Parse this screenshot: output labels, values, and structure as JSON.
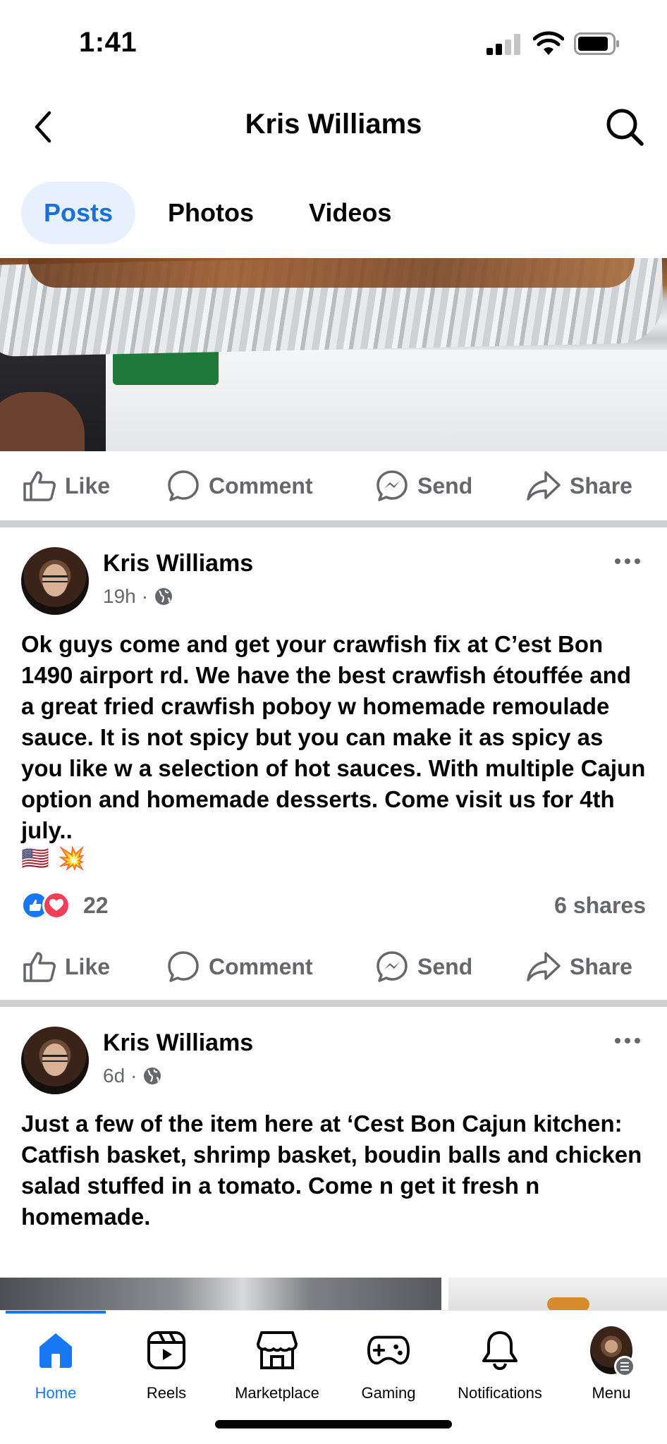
{
  "status_bar": {
    "time": "1:41"
  },
  "header": {
    "title": "Kris Williams"
  },
  "tabs": [
    {
      "label": "Posts",
      "active": true
    },
    {
      "label": "Photos",
      "active": false
    },
    {
      "label": "Videos",
      "active": false
    }
  ],
  "actions": {
    "like": "Like",
    "comment": "Comment",
    "send": "Send",
    "share": "Share"
  },
  "posts": [
    {
      "author": "Kris Williams",
      "time": "19h",
      "separator": "·",
      "text": "Ok guys come and get your crawfish fix at C’est Bon 1490 airport rd.  We have the best crawfish étouffée and a great fried crawfish poboy w homemade remoulade sauce.  It is not spicy but you can make it as spicy as you like w a selection of hot sauces.  With multiple Cajun option and homemade desserts.  Come visit us for 4th july..",
      "emojis": [
        "🇺🇸",
        "💥"
      ],
      "reaction_count": "22",
      "shares": "6 shares"
    },
    {
      "author": "Kris Williams",
      "time": "6d",
      "separator": "·",
      "text": "Just a few of the item here at ‘Cest Bon Cajun kitchen:\nCatfish basket, shrimp basket, boudin balls and chicken salad stuffed in a tomato.  Come n get it fresh n homemade."
    }
  ],
  "bottom_nav": [
    {
      "label": "Home",
      "icon": "home-icon",
      "active": true
    },
    {
      "label": "Reels",
      "icon": "reels-icon",
      "active": false
    },
    {
      "label": "Marketplace",
      "icon": "marketplace-icon",
      "active": false
    },
    {
      "label": "Gaming",
      "icon": "gaming-icon",
      "active": false
    },
    {
      "label": "Notifications",
      "icon": "bell-icon",
      "active": false
    },
    {
      "label": "Menu",
      "icon": "profile-avatar",
      "active": false
    }
  ],
  "colors": {
    "accent": "#1877f2",
    "tab_active_bg": "#e7f0fd",
    "secondary_text": "#65676b",
    "love": "#f33e58",
    "divider": "#ced0d4"
  }
}
